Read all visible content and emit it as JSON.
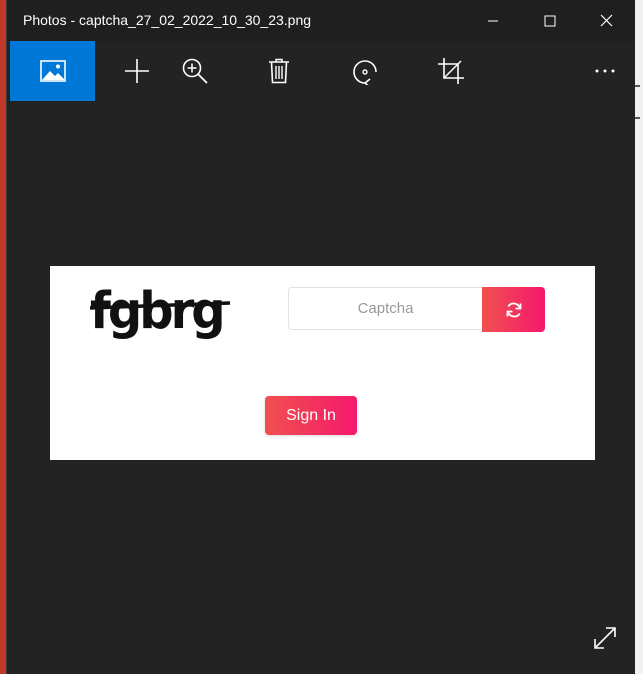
{
  "window": {
    "title": "Photos - captcha_27_02_2022_10_30_23.png",
    "controls": {
      "minimize_icon": "minimize-icon",
      "maximize_icon": "maximize-icon",
      "close_icon": "close-icon"
    }
  },
  "toolbar": {
    "items": [
      {
        "icon": "image-icon",
        "active": true
      },
      {
        "icon": "add-icon"
      },
      {
        "icon": "zoom-in-icon"
      },
      {
        "icon": "delete-icon"
      },
      {
        "icon": "rotate-icon"
      },
      {
        "icon": "crop-icon"
      },
      {
        "icon": "more-icon"
      }
    ],
    "active_color": "#0078d7"
  },
  "image": {
    "captcha_text": "fgbrg",
    "captcha_placeholder": "Captcha",
    "refresh_icon": "refresh-icon",
    "signin_label": "Sign In",
    "accent_gradient": [
      "#f0504f",
      "#f5196b"
    ]
  },
  "footer": {
    "expand_icon": "fullscreen-icon"
  }
}
